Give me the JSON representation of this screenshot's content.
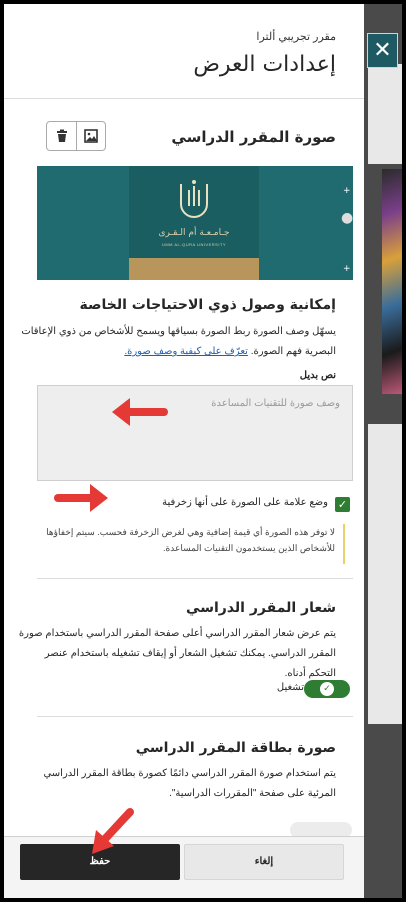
{
  "header": {
    "course_name": "مقرر تجريبي ألترا",
    "title": "إعدادات العرض",
    "close_label": "✕"
  },
  "course_image": {
    "title": "صورة المقرر الدراسي",
    "banner_logo_text": "جـامـعـة أم الـقـرى",
    "banner_logo_en": "UMM AL-QURA UNIVERSITY",
    "icons": [
      "delete-icon",
      "image-icon"
    ]
  },
  "accessibility": {
    "title": "إمكانية وصول ذوي الاحتياجات الخاصة",
    "description": "يسهّل وصف الصورة ربط الصورة بسياقها ويسمح للأشخاص من ذوي الإعاقات البصرية فهم الصورة.",
    "link": "تعرّف على كيفية وصف صورة.",
    "alt_label": "نص بديل",
    "alt_placeholder": "وصف صورة للتقنيات المساعدة",
    "decorative_label": "وضع علامة على الصورة على أنها زخرفية",
    "decorative_checked": true,
    "note": "لا توفر هذه الصورة أي قيمة إضافية وهي لغرض الزخرفة فحسب. سيتم إخفاؤها للأشخاص الذين يستخدمون التقنيات المساعدة."
  },
  "course_banner": {
    "title": "شعار المقرر الدراسي",
    "description": "يتم عرض شعار المقرر الدراسي أعلى صفحة المقرر الدراسي باستخدام صورة المقرر الدراسي. يمكنك تشغيل الشعار أو إيقاف تشغيله باستخدام عنصر التحكم أدناه.",
    "toggle_label": "تشغيل",
    "toggle_on": true
  },
  "course_card": {
    "title": "صورة بطاقة المقرر الدراسي",
    "description": "يتم استخدام صورة المقرر الدراسي دائمًا كصورة بطاقة المقرر الدراسي المرئية على صفحة \"المقررات الدراسية\"."
  },
  "footer": {
    "cancel_label": "إلغاء",
    "save_label": "حفظ"
  },
  "colors": {
    "accent_green": "#2e7d32",
    "close_bg": "#1e5a63",
    "arrow_red": "#e53935"
  }
}
